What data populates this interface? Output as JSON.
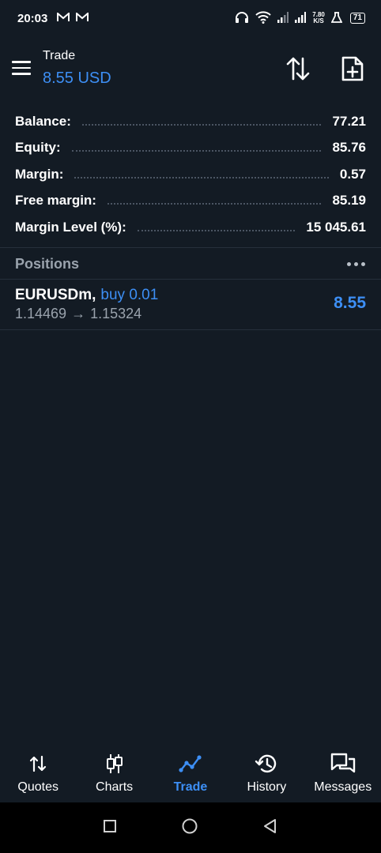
{
  "status_bar": {
    "time": "20:03",
    "notif_icons": [
      "gmail-icon",
      "gmail-icon"
    ],
    "speed_value": "7.80",
    "speed_unit": "K/S",
    "battery": "71"
  },
  "header": {
    "title": "Trade",
    "amount": "8.55 USD",
    "amount_color": "#3d8ff5"
  },
  "summary": {
    "balance_label": "Balance:",
    "balance_value": "77.21",
    "equity_label": "Equity:",
    "equity_value": "85.76",
    "margin_label": "Margin:",
    "margin_value": "0.57",
    "free_margin_label": "Free margin:",
    "free_margin_value": "85.19",
    "margin_level_label": "Margin Level (%):",
    "margin_level_value": "15 045.61"
  },
  "positions": {
    "title": "Positions",
    "items": [
      {
        "symbol": "EURUSDm",
        "comma": ",",
        "direction": "buy 0.01",
        "open_price": "1.14469",
        "arrow": "→",
        "current_price": "1.15324",
        "profit": "8.55"
      }
    ]
  },
  "bottom_nav": {
    "items": [
      {
        "label": "Quotes",
        "icon": "quotes-icon"
      },
      {
        "label": "Charts",
        "icon": "charts-icon"
      },
      {
        "label": "Trade",
        "icon": "trade-icon",
        "active": true
      },
      {
        "label": "History",
        "icon": "history-icon"
      },
      {
        "label": "Messages",
        "icon": "messages-icon"
      }
    ]
  },
  "colors": {
    "background": "#131b24",
    "accent": "#3d8ff5",
    "muted": "#9aa3ad"
  }
}
